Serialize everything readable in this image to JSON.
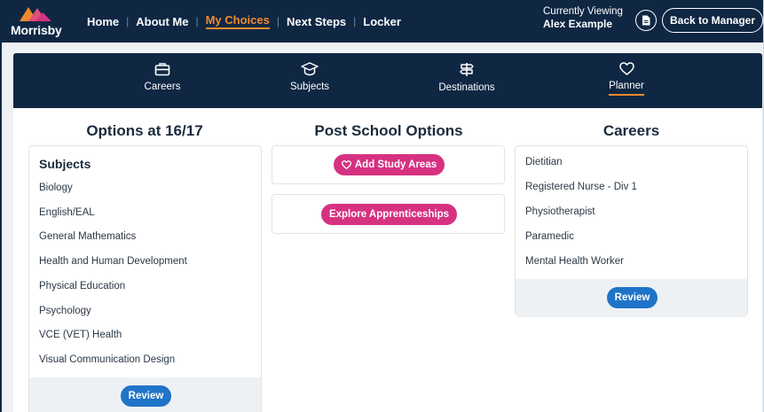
{
  "brand": {
    "name": "Morrisby",
    "logo_colors": [
      "#f0892c",
      "#e14e7a",
      "#d63281"
    ]
  },
  "top_nav": {
    "items": [
      {
        "label": "Home",
        "active": false
      },
      {
        "label": "About Me",
        "active": false
      },
      {
        "label": "My Choices",
        "active": true
      },
      {
        "label": "Next Steps",
        "active": false
      },
      {
        "label": "Locker",
        "active": false
      }
    ]
  },
  "viewing": {
    "label": "Currently Viewing",
    "user": "Alex Example",
    "icon": "document-icon"
  },
  "back_button": "Back to Manager",
  "sub_nav": {
    "tabs": [
      {
        "label": "Careers",
        "icon": "briefcase-icon",
        "active": false
      },
      {
        "label": "Subjects",
        "icon": "graduation-cap-icon",
        "active": false
      },
      {
        "label": "Destinations",
        "icon": "signpost-icon",
        "active": false
      },
      {
        "label": "Planner",
        "icon": "heart-icon",
        "active": true
      }
    ]
  },
  "options": {
    "title": "Options at 16/17",
    "heading": "Subjects",
    "items": [
      "Biology",
      "English/EAL",
      "General Mathematics",
      "Health and Human Development",
      "Physical Education",
      "Psychology",
      "VCE (VET) Health",
      "Visual Communication Design"
    ],
    "review": "Review"
  },
  "post_school": {
    "title": "Post School Options",
    "add_study": "Add Study Areas",
    "explore": "Explore Apprenticeships"
  },
  "careers": {
    "title": "Careers",
    "items": [
      "Dietitian",
      "Registered Nurse - Div 1",
      "Physiotherapist",
      "Paramedic",
      "Mental Health Worker"
    ],
    "review": "Review"
  },
  "colors": {
    "navy": "#0f2743",
    "accent_orange": "#f08a2e",
    "button_blue": "#1f74c9",
    "button_pink": "#d63281"
  }
}
